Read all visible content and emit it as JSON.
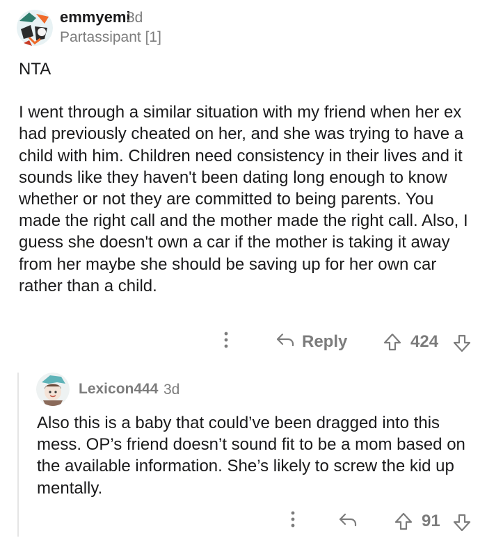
{
  "top_comment": {
    "username": "emmyemi",
    "age": "3d",
    "flair": "Partassipant [1]",
    "body_first": "NTA",
    "body_second": "I went through a similar situation with my friend when her ex had previously cheated on her, and she was trying to have a child with him. Children need consistency in their lives and it sounds like they haven't been dating long enough to know whether or not they are committed to being parents. You made the right call and the mother made the right call. Also, I guess she doesn't own a car if the mother is taking it away from her maybe she should be saving up for her own car rather than a child.",
    "actions": {
      "more_icon": "more-vertical-icon",
      "reply_icon": "reply-arrow-icon",
      "reply_label": "Reply",
      "upvote_icon": "arrow-up-icon",
      "score": "424",
      "downvote_icon": "arrow-down-icon"
    }
  },
  "reply_comment": {
    "username": "Lexicon444",
    "age": "3d",
    "body": "Also this is a baby that could’ve been dragged into this mess. OP’s friend doesn’t sound fit to be a mom based on the available information. She’s likely to screw the kid up mentally.",
    "actions": {
      "more_icon": "more-vertical-icon",
      "reply_icon": "reply-arrow-icon",
      "upvote_icon": "arrow-up-icon",
      "score": "91",
      "downvote_icon": "arrow-down-icon"
    }
  },
  "colors": {
    "text": "#1a1a1b",
    "meta": "#7c7c7c",
    "thread_line": "#e5e5e5"
  }
}
